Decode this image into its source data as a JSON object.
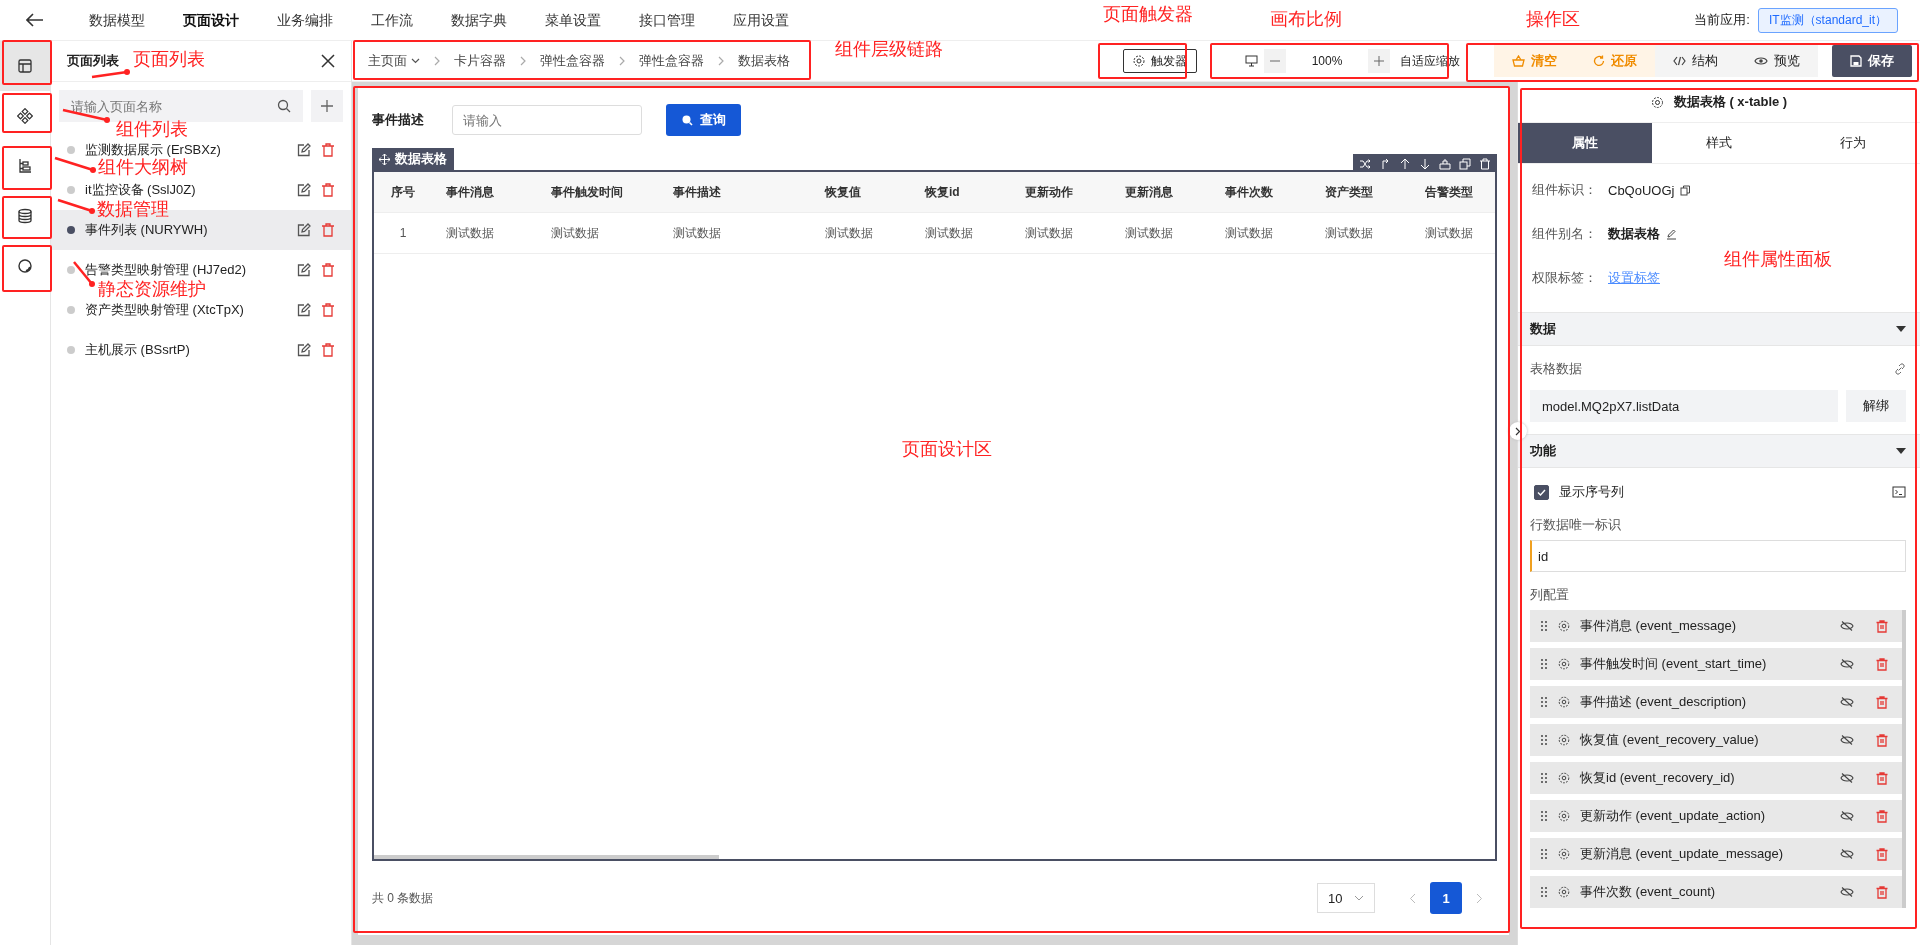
{
  "top_nav": {
    "items": [
      {
        "label": "数据模型",
        "selected": false
      },
      {
        "label": "页面设计",
        "selected": true
      },
      {
        "label": "业务编排",
        "selected": false
      },
      {
        "label": "工作流",
        "selected": false
      },
      {
        "label": "数据字典",
        "selected": false
      },
      {
        "label": "菜单设置",
        "selected": false
      },
      {
        "label": "接口管理",
        "selected": false
      },
      {
        "label": "应用设置",
        "selected": false
      }
    ],
    "current_app_label": "当前应用:",
    "current_app": "IT监测（standard_it）"
  },
  "rail": [
    {
      "kind": "layout",
      "selected": true
    },
    {
      "kind": "components",
      "selected": false
    },
    {
      "kind": "outline",
      "selected": false
    },
    {
      "kind": "database",
      "selected": false
    },
    {
      "kind": "resource",
      "selected": false
    }
  ],
  "page_list": {
    "title": "页面列表",
    "search_placeholder": "请输入页面名称",
    "pages": [
      {
        "name": "监测数据展示 (ErSBXz)",
        "selected": false
      },
      {
        "name": "it监控设备 (SslJ0Z)",
        "selected": false
      },
      {
        "name": "事件列表 (NURYWH)",
        "selected": true
      },
      {
        "name": "告警类型映射管理 (HJ7ed2)",
        "selected": false
      },
      {
        "name": "资产类型映射管理 (XtcTpX)",
        "selected": false
      },
      {
        "name": "主机展示 (BSsrtP)",
        "selected": false
      }
    ]
  },
  "breadcrumb": [
    "主页面",
    "卡片容器",
    "弹性盒容器",
    "弹性盒容器",
    "数据表格"
  ],
  "trigger_button": "触发器",
  "zoom": {
    "value": "100%",
    "fit_label": "自适应缩放"
  },
  "actions": [
    {
      "label": "清空",
      "kind": "clear"
    },
    {
      "label": "还原",
      "kind": "restore"
    },
    {
      "label": "结构",
      "kind": "structure"
    },
    {
      "label": "预览",
      "kind": "preview"
    },
    {
      "label": "保存",
      "kind": "save"
    }
  ],
  "canvas": {
    "filter_label": "事件描述",
    "filter_placeholder": "请输入",
    "query_button": "查询",
    "table_tag": "数据表格",
    "columns": [
      "序号",
      "事件消息",
      "事件触发时间",
      "事件描述",
      "恢复值",
      "恢复id",
      "更新动作",
      "更新消息",
      "事件次数",
      "资产类型",
      "告警类型"
    ],
    "rows": [
      [
        "1",
        "测试数据",
        "测试数据",
        "测试数据",
        "测试数据",
        "测试数据",
        "测试数据",
        "测试数据",
        "测试数据",
        "测试数据",
        "测试数据"
      ]
    ],
    "total": "共 0 条数据",
    "page_size": "10",
    "pages": [
      {
        "label": "1",
        "selected": true
      }
    ]
  },
  "props_panel": {
    "title": "数据表格 ( x-table )",
    "tabs": [
      {
        "label": "属性",
        "selected": true
      },
      {
        "label": "样式",
        "selected": false
      },
      {
        "label": "行为",
        "selected": false
      }
    ],
    "fields": [
      {
        "label": "组件标识：",
        "value": "CbQoUOGj",
        "kind": "copy"
      },
      {
        "label": "组件别名：",
        "value": "数据表格",
        "kind": "edit"
      },
      {
        "label": "权限标签：",
        "value": "设置标签",
        "kind": "link"
      }
    ],
    "data_section": {
      "title": "数据",
      "table_data_label": "表格数据",
      "binding": "model.MQ2pX7.listData",
      "unbind_button": "解绑"
    },
    "feature_section": {
      "title": "功能",
      "show_index": {
        "label": "显示序号列",
        "checked": true
      },
      "row_key_label": "行数据唯一标识",
      "row_key": "id",
      "columns_label": "列配置",
      "columns": [
        "事件消息 (event_message)",
        "事件触发时间 (event_start_time)",
        "事件描述 (event_description)",
        "恢复值 (event_recovery_value)",
        "恢复id (event_recovery_id)",
        "更新动作 (event_update_action)",
        "更新消息 (event_update_message)",
        "事件次数 (event_count)"
      ]
    }
  },
  "annotations": [
    "页面列表",
    "组件列表",
    "组件大纲树",
    "数据管理",
    "静态资源维护",
    "组件层级链路",
    "页面触发器",
    "画布比例",
    "操作区",
    "页面设计区",
    "组件属性面板"
  ]
}
